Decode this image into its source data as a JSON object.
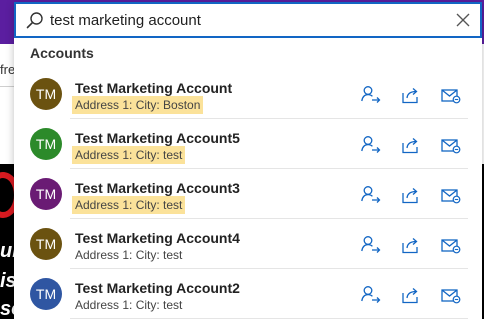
{
  "background": {
    "fragment_text": "fre",
    "italic_lines": [
      "un",
      "is",
      "so"
    ]
  },
  "search": {
    "value": "test marketing account",
    "placeholder": ""
  },
  "section": {
    "title": "Accounts"
  },
  "results": [
    {
      "initials": "TM",
      "name": "Test Marketing Account",
      "address": "Address 1: City: Boston",
      "avatar_color": "#6b5210",
      "highlighted": true
    },
    {
      "initials": "TM",
      "name": "Test Marketing Account5",
      "address": "Address 1: City: test",
      "avatar_color": "#2c8a2a",
      "highlighted": true
    },
    {
      "initials": "TM",
      "name": "Test Marketing Account3",
      "address": "Address 1: City: test",
      "avatar_color": "#6a1b74",
      "highlighted": true
    },
    {
      "initials": "TM",
      "name": "Test Marketing Account4",
      "address": "Address 1: City: test",
      "avatar_color": "#6b5210",
      "highlighted": false
    },
    {
      "initials": "TM",
      "name": "Test Marketing Account2",
      "address": "Address 1: City: test",
      "avatar_color": "#2f56a2",
      "highlighted": false
    }
  ],
  "colors": {
    "accent": "#1266c4",
    "highlight": "#fbe29a",
    "header_bar": "#5b1ea0"
  },
  "icons": {
    "assign": "assign-user-icon",
    "share": "share-icon",
    "email": "email-link-icon"
  }
}
